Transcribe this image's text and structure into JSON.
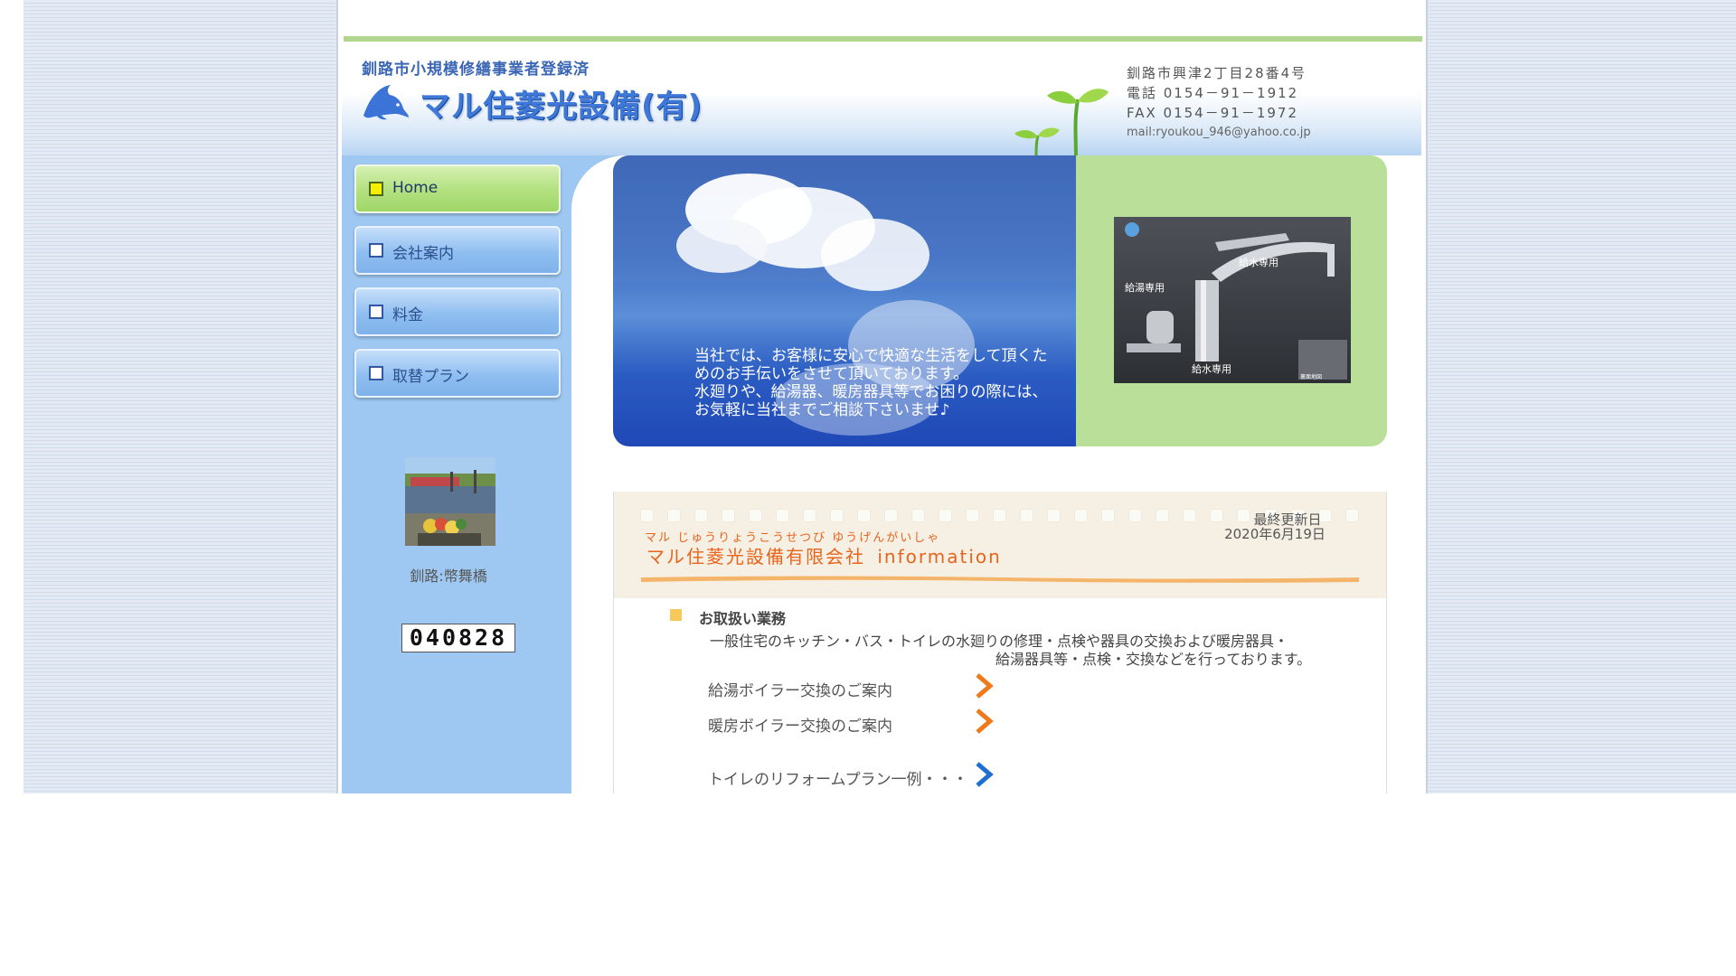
{
  "header": {
    "tagline": "釧路市小規模修繕事業者登録済",
    "company_name": "マル住菱光設備(有)",
    "address": "釧路市興津2丁目28番4号",
    "phone": "電話  0154－91－1912",
    "fax": "FAX  0154－91－1972",
    "email": "mail:ryoukou_946@yahoo.co.jp"
  },
  "nav": {
    "items": [
      {
        "label": "Home",
        "active": true
      },
      {
        "label": "会社案内",
        "active": false
      },
      {
        "label": "料金",
        "active": false
      },
      {
        "label": "取替プラン",
        "active": false
      }
    ]
  },
  "sidebar": {
    "photo_caption": "釧路:幣舞橋",
    "counter": "040828"
  },
  "hero": {
    "lines": [
      "当社では、お客様に安心で快適な生活をして頂くた",
      "めのお手伝いをさせて頂いております。",
      "水廻りや、給湯器、暖房器具等でお困りの際には、",
      "お気軽に当社までご相談下さいませ♪"
    ],
    "faucet_labels": {
      "label_water_top": "給水専用",
      "label_hot": "給湯専用",
      "label_water_bottom": "給水専用",
      "label_small": "裏面地図"
    }
  },
  "info": {
    "ruby": "マル  じゅうりょうこうせつび  ゆうげんがいしゃ",
    "title": "マル住菱光設備有限会社",
    "title_suffix": "information",
    "updated_label": "最終更新日",
    "updated_date": "2020年6月19日",
    "services_title": "お取扱い業務",
    "services_line1": "一般住宅のキッチン・バス・トイレの水廻りの修理・点検や器具の交換および暖房器具・",
    "services_line2": "給湯器具等・点検・交換などを行っております。",
    "links": [
      {
        "label": "給湯ボイラー交換のご案内",
        "icon": "chevron-right-orange-icon"
      },
      {
        "label": "暖房ボイラー交換のご案内",
        "icon": "chevron-right-orange-icon"
      },
      {
        "label": "トイレのリフォームプラン一例・・・",
        "icon": "chevron-right-blue-icon"
      }
    ]
  },
  "colors": {
    "accent_blue": "#3e78d8",
    "sidebar_blue": "#9ec8f2",
    "nav_active_green": "#b2e07e",
    "info_orange": "#e8641c",
    "hero_green": "#b9df98"
  }
}
